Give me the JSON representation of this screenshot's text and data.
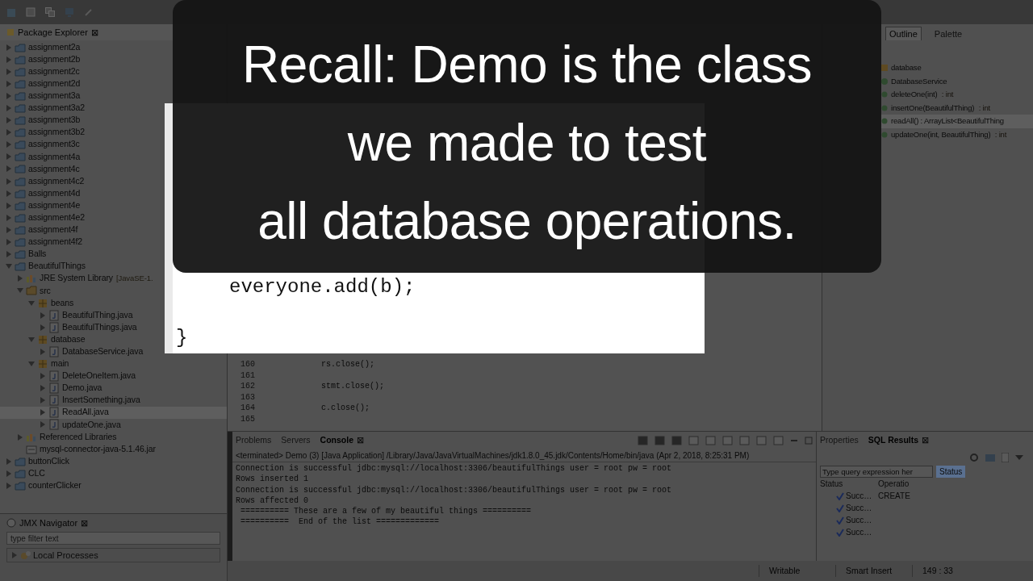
{
  "caption": {
    "lines": [
      "Recall: Demo is the class",
      "we made to test",
      "all database operations."
    ]
  },
  "package_explorer": {
    "title": "Package Explorer",
    "close": "⊠",
    "tree": [
      {
        "label": "assignment2a",
        "kind": "project",
        "expanded": false,
        "selected": false
      },
      {
        "label": "assignment2b",
        "kind": "project",
        "expanded": false,
        "selected": false
      },
      {
        "label": "assignment2c",
        "kind": "project",
        "expanded": false,
        "selected": false
      },
      {
        "label": "assignment2d",
        "kind": "project",
        "expanded": false,
        "selected": false
      },
      {
        "label": "assignment3a",
        "kind": "project",
        "expanded": false,
        "selected": false
      },
      {
        "label": "assignment3a2",
        "kind": "project",
        "expanded": false,
        "selected": false
      },
      {
        "label": "assignment3b",
        "kind": "project",
        "expanded": false,
        "selected": false
      },
      {
        "label": "assignment3b2",
        "kind": "project",
        "expanded": false,
        "selected": false
      },
      {
        "label": "assignment3c",
        "kind": "project",
        "expanded": false,
        "selected": false
      },
      {
        "label": "assignment4a",
        "kind": "project",
        "expanded": false,
        "selected": false
      },
      {
        "label": "assignment4c",
        "kind": "project",
        "expanded": false,
        "selected": false
      },
      {
        "label": "assignment4c2",
        "kind": "project",
        "expanded": false,
        "selected": false
      },
      {
        "label": "assignment4d",
        "kind": "project",
        "expanded": false,
        "selected": false
      },
      {
        "label": "assignment4e",
        "kind": "project",
        "expanded": false,
        "selected": false
      },
      {
        "label": "assignment4e2",
        "kind": "project",
        "expanded": false,
        "selected": false
      },
      {
        "label": "assignment4f",
        "kind": "project",
        "expanded": false,
        "selected": false
      },
      {
        "label": "assignment4f2",
        "kind": "project",
        "expanded": false,
        "selected": false
      },
      {
        "label": "Balls",
        "kind": "project",
        "expanded": false,
        "selected": false
      },
      {
        "label": "BeautifulThings",
        "kind": "project",
        "expanded": true,
        "selected": false,
        "children": [
          {
            "label": "JRE System Library",
            "note": "[JavaSE-1.",
            "kind": "library",
            "expanded": false,
            "selected": false
          },
          {
            "label": "src",
            "kind": "folder",
            "expanded": true,
            "selected": false,
            "children": [
              {
                "label": "beans",
                "kind": "package",
                "expanded": true,
                "selected": false,
                "children": [
                  {
                    "label": "BeautifulThing.java",
                    "kind": "java",
                    "expanded": false,
                    "selected": false
                  },
                  {
                    "label": "BeautifulThings.java",
                    "kind": "java",
                    "expanded": false,
                    "selected": false
                  }
                ]
              },
              {
                "label": "database",
                "kind": "package",
                "expanded": true,
                "selected": false,
                "children": [
                  {
                    "label": "DatabaseService.java",
                    "kind": "java",
                    "expanded": false,
                    "selected": false
                  }
                ]
              },
              {
                "label": "main",
                "kind": "package",
                "expanded": true,
                "selected": false,
                "children": [
                  {
                    "label": "DeleteOneItem.java",
                    "kind": "java",
                    "expanded": false,
                    "selected": false
                  },
                  {
                    "label": "Demo.java",
                    "kind": "java",
                    "expanded": false,
                    "selected": false
                  },
                  {
                    "label": "InsertSomething.java",
                    "kind": "java",
                    "expanded": false,
                    "selected": false
                  },
                  {
                    "label": "ReadAll.java",
                    "kind": "java",
                    "expanded": false,
                    "selected": true
                  },
                  {
                    "label": "updateOne.java",
                    "kind": "java",
                    "expanded": false,
                    "selected": false
                  }
                ]
              }
            ]
          },
          {
            "label": "Referenced Libraries",
            "kind": "library",
            "expanded": false,
            "selected": false
          },
          {
            "label": "mysql-connector-java-5.1.46.jar",
            "kind": "jar",
            "selected": false
          }
        ]
      },
      {
        "label": "buttonClick",
        "kind": "project",
        "expanded": false,
        "selected": false
      },
      {
        "label": "CLC",
        "kind": "project",
        "expanded": false,
        "selected": false
      },
      {
        "label": "counterClicker",
        "kind": "project",
        "expanded": false,
        "selected": false
      }
    ]
  },
  "jmx_navigator": {
    "title": "JMX Navigator",
    "close": "⊠",
    "filter_placeholder": "type filter text",
    "tree": [
      {
        "label": "Local Processes",
        "expanded": false
      }
    ]
  },
  "zoom_inset": {
    "lines": [
      {
        "text": "everyone.add(b);",
        "kind": "code"
      },
      {
        "kind": "blank"
      },
      {
        "text": "}",
        "kind": "brace"
      }
    ]
  },
  "editor": {
    "lines": [
      {
        "number": "160",
        "text": "rs.close();"
      },
      {
        "number": "161"
      },
      {
        "number": "162",
        "text": "stmt.close();"
      },
      {
        "number": "163"
      },
      {
        "number": "164",
        "text": "c.close();"
      },
      {
        "number": "165"
      }
    ]
  },
  "console": {
    "tabs": [
      {
        "label": "Problems",
        "selected": false
      },
      {
        "label": "Servers",
        "selected": false
      },
      {
        "label": "Console",
        "selected": true
      }
    ],
    "close": "⊠",
    "header": "<terminated> Demo (3) [Java Application] /Library/Java/JavaVirtualMachines/jdk1.8.0_45.jdk/Contents/Home/bin/java (Apr 2, 2018, 8:25:31 PM)",
    "lines": [
      "Connection is successful jdbc:mysql://localhost:3306/beautifulThings user = root pw = root",
      "Rows inserted 1",
      "Connection is successful jdbc:mysql://localhost:3306/beautifulThings user = root pw = root",
      "Rows affected 0",
      " ========== These are a few of my beautiful things ==========",
      " ==========  End of the list ============="
    ]
  },
  "outline": {
    "tabs": [
      {
        "label": "Outline",
        "selected": true
      },
      {
        "label": "Palette",
        "selected": false
      }
    ],
    "items": [
      {
        "label": "database",
        "kind": "package",
        "selected": false
      },
      {
        "label": "DatabaseService",
        "kind": "class",
        "selected": false
      },
      {
        "label": "deleteOne(int)",
        "type": " : int",
        "kind": "method",
        "selected": false
      },
      {
        "label": "insertOne(BeautifulThing)",
        "type": " : int",
        "kind": "method",
        "selected": false
      },
      {
        "label": "readAll() : ArrayList<BeautifulThing",
        "kind": "method",
        "selected": true
      },
      {
        "label": "updateOne(int, BeautifulThing)",
        "type": " : int",
        "kind": "method",
        "selected": false
      }
    ]
  },
  "sql_results": {
    "tabs": [
      {
        "label": "Properties",
        "selected": false
      },
      {
        "label": "SQL Results",
        "selected": true
      }
    ],
    "close": "⊠",
    "query_placeholder": "Type query expression her",
    "status_tab": "Status",
    "columns": [
      "Status",
      "Operatio"
    ],
    "rows": [
      [
        "Succ…",
        "CREATE"
      ],
      [
        "Succ…"
      ],
      [
        "Succ…"
      ],
      [
        "Succ…"
      ]
    ]
  },
  "status_bar": [
    "Writable",
    "Smart Insert",
    "149 : 33"
  ]
}
